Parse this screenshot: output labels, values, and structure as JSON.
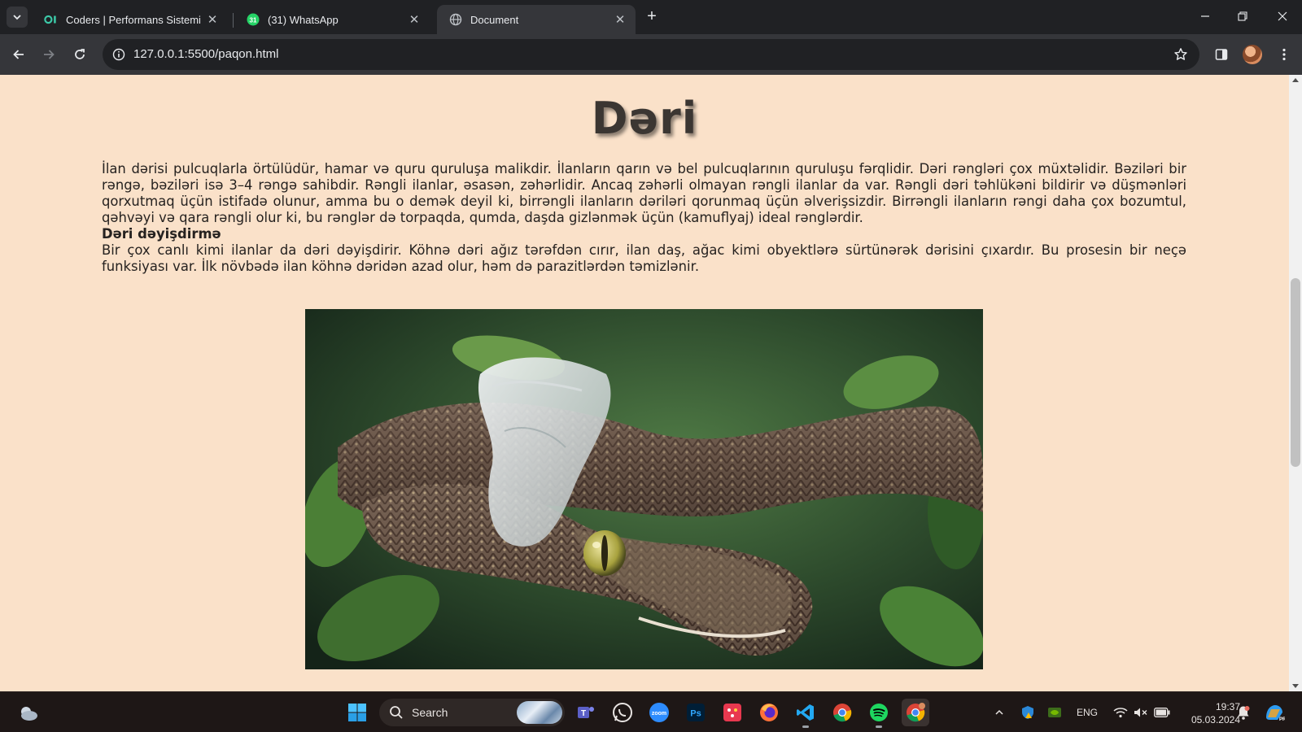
{
  "browser": {
    "tabs": [
      {
        "title": "Coders | Performans Sistemi",
        "icon": "coders-favicon",
        "active": false
      },
      {
        "title": "(31) WhatsApp",
        "icon": "whatsapp-favicon",
        "active": false
      },
      {
        "title": "Document",
        "icon": "globe-favicon",
        "active": true
      }
    ],
    "url": "127.0.0.1:5500/paqon.html"
  },
  "page": {
    "title": "Dəri",
    "paragraph1": "İlan dərisi pulcuqlarla örtülüdür, hamar və quru quruluşa malikdir. İlanların qarın və bel pulcuqlarının quruluşu fərqlidir. Dəri rəngləri çox müxtəlidir. Bəziləri bir rəngə, bəziləri isə 3–4 rəngə sahibdir. Rəngli ilanlar, əsasən, zəhərlidir. Ancaq zəhərli olmayan rəngli ilanlar da var. Rəngli dəri təhlükəni bildirir və düşmənləri qorxutmaq üçün istifadə olunur, amma bu o demək deyil ki, birrəngli ilanların dəriləri qorunmaq üçün əlverişsizdir. Birrəngli ilanların rəngi daha çox bozumtul, qəhvəyi və qara rəngli olur ki, bu rənglər də torpaqda, qumda, daşda gizlənmək üçün (kamuflyaj) ideal rənglərdir.",
    "heading2": "Dəri dəyişdirmə",
    "paragraph2": "Bir çox canlı kimi ilanlar da dəri dəyişdirir. Köhnə dəri ağız tərəfdən cırır, ilan daş, ağac kimi obyektlərə sürtünərək dərisini çıxardır. Bu prosesin bir neçə funksiyası var. İlk növbədə ilan köhnə dəridən azad olur, həm də parazitlərdən təmizlənir.",
    "background_color": "#fae1c9",
    "image_icon": "snake-shedding-photo"
  },
  "taskbar": {
    "search_label": "Search",
    "apps": [
      "weather-icon",
      "windows-start-icon",
      "teams-icon",
      "whatsapp-icon",
      "zoom-icon",
      "photoshop-icon",
      "calendar-app-icon",
      "firefox-icon",
      "vscode-icon",
      "chrome-icon",
      "spotify-icon",
      "chrome-profile-icon"
    ],
    "language": "ENG",
    "time": "19:37",
    "date": "05.03.2024"
  }
}
